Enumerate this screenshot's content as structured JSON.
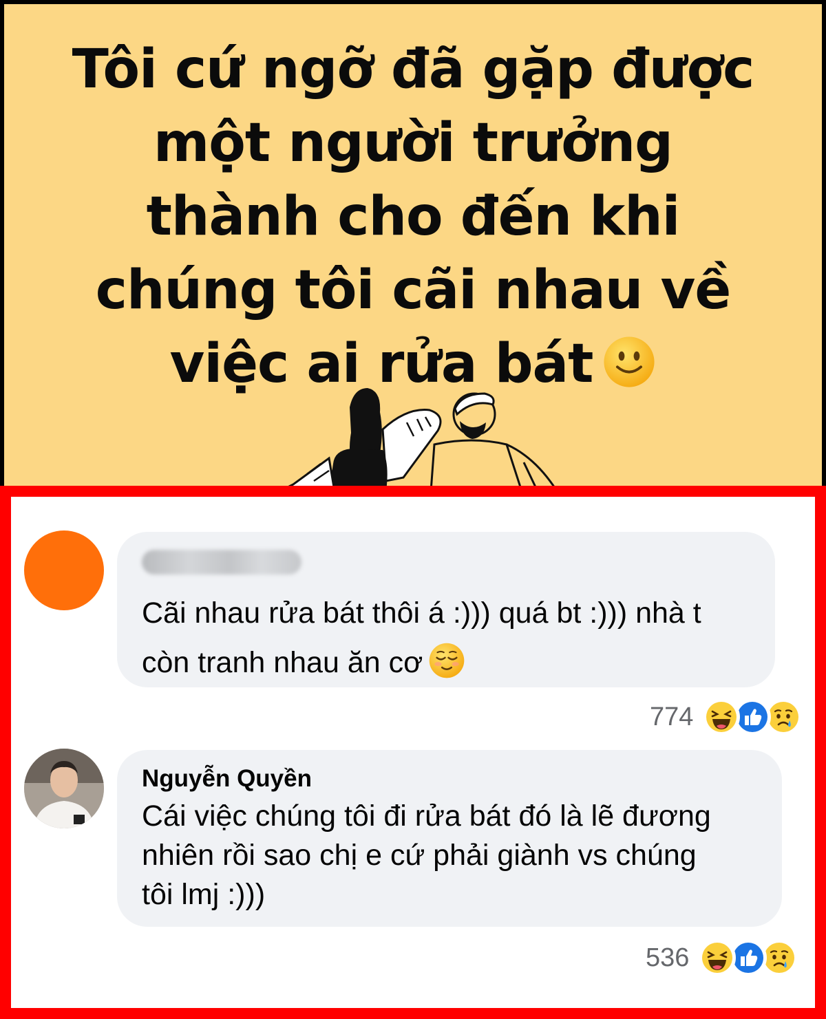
{
  "post": {
    "headline_lines": [
      "Tôi cứ ngỡ đã gặp được",
      "một người trưởng",
      "thành cho đến khi",
      "chúng tôi cãi nhau về",
      "việc ai rửa bát"
    ],
    "headline_emoji": "slightly-smiling-face-icon",
    "background_color": "#fcd785"
  },
  "frame": {
    "border_color": "#ff0000"
  },
  "comments": [
    {
      "author": "",
      "author_blurred": true,
      "avatar_color": "#ff6f0a",
      "text_lines": [
        "Cãi nhau rửa bát thôi á :))) quá bt :))) nhà t",
        "còn tranh nhau ăn cơ"
      ],
      "text_emoji": "relieved-face-icon",
      "reaction_count": "774",
      "reactions": [
        "haha-icon",
        "like-icon",
        "sad-icon"
      ]
    },
    {
      "author": "Nguyễn Quyền",
      "author_blurred": false,
      "text_lines": [
        "Cái việc chúng tôi đi rửa bát đó là lẽ đương",
        "nhiên rồi sao chị e cứ phải giành vs chúng",
        "tôi lmj :)))"
      ],
      "reaction_count": "536",
      "reactions": [
        "haha-icon",
        "like-icon",
        "sad-icon"
      ]
    }
  ]
}
